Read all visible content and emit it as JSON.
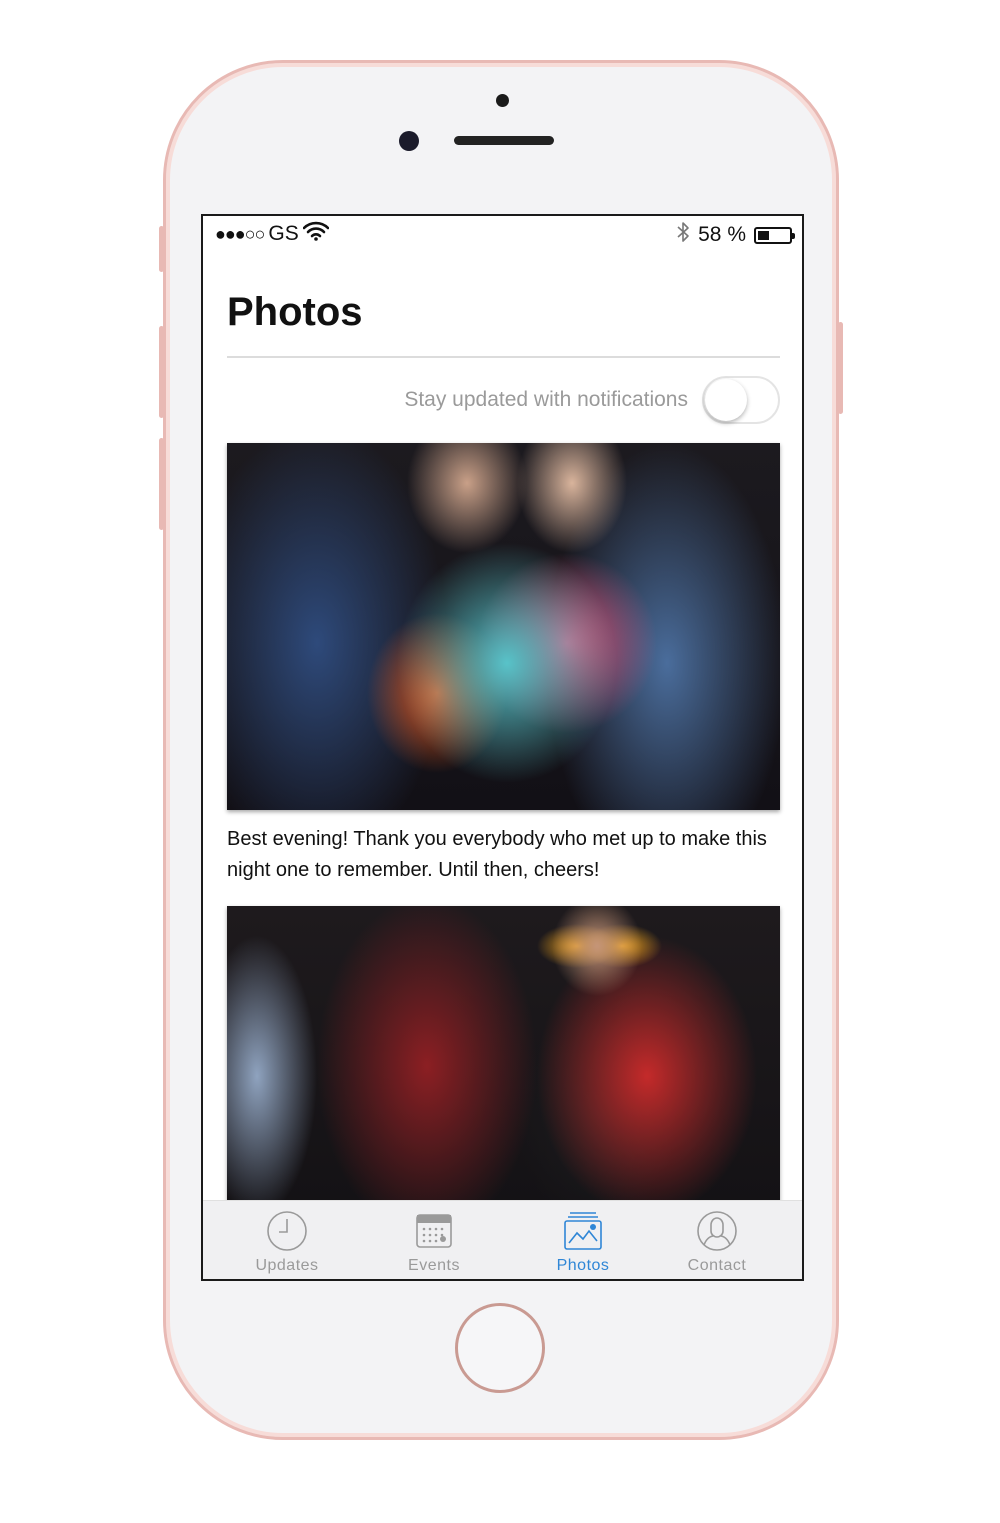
{
  "status_bar": {
    "signal": "●●●○○",
    "carrier": "GS",
    "battery_percent": "58 %",
    "battery_level": 0.35
  },
  "page": {
    "title": "Photos",
    "notify_label": "Stay updated with notifications",
    "notify_enabled": false
  },
  "posts": [
    {
      "caption": "Best evening! Thank you everybody who met up to make this night one to remember. Until then, cheers!"
    }
  ],
  "tabs": [
    {
      "label": "Updates",
      "icon": "clock-icon",
      "active": false
    },
    {
      "label": "Events",
      "icon": "calendar-icon",
      "active": false
    },
    {
      "label": "Photos",
      "icon": "photos-icon",
      "active": true
    },
    {
      "label": "Contact",
      "icon": "person-icon",
      "active": false
    }
  ],
  "colors": {
    "accent": "#2f86d6",
    "inactive": "#9a9a9a",
    "phone_frame": "#e8b9b4"
  }
}
